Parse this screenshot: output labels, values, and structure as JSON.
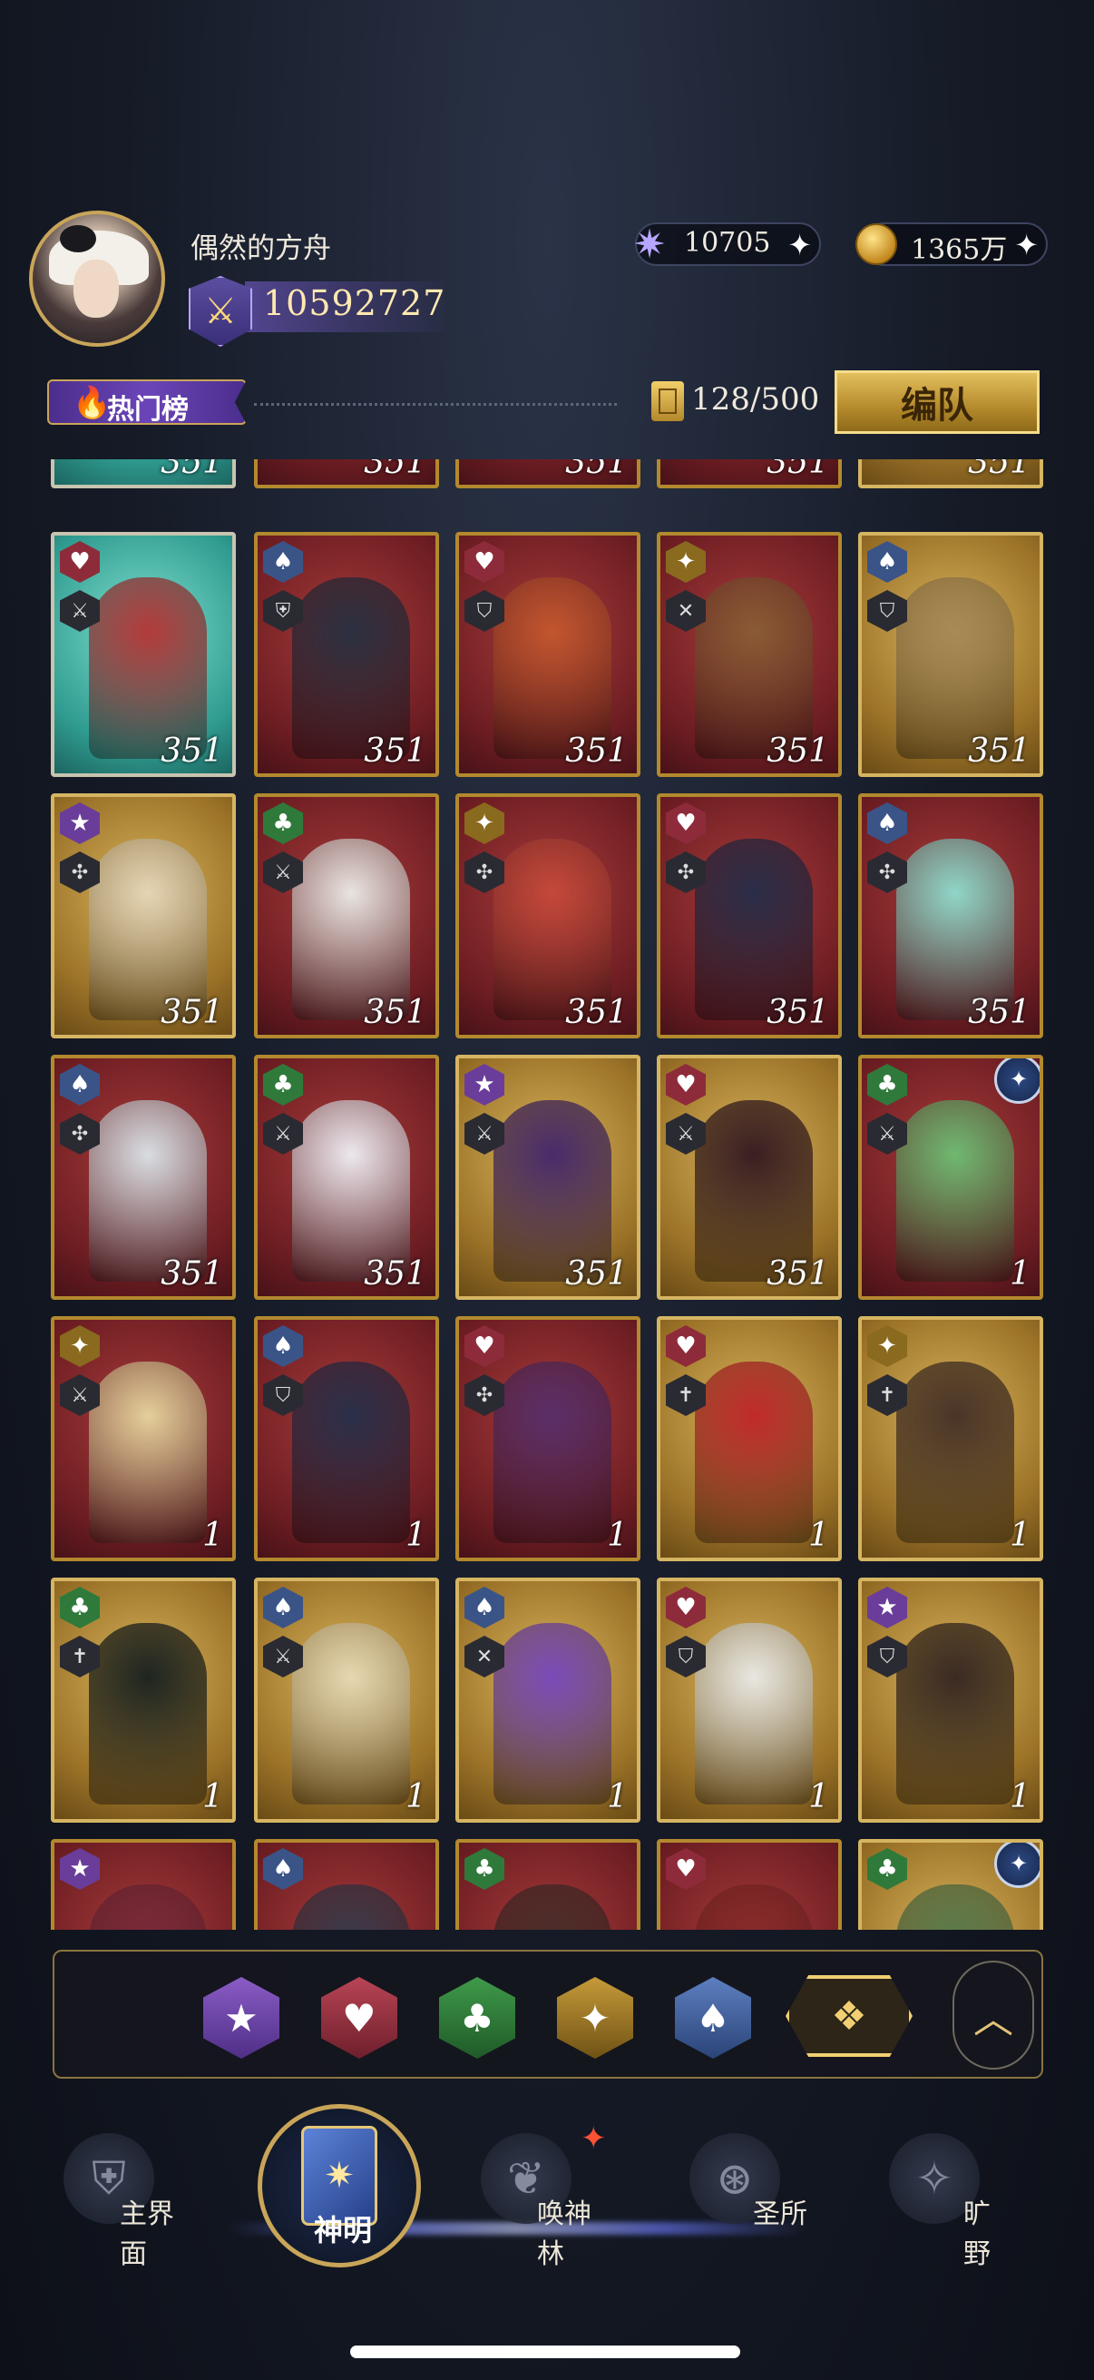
{
  "player": {
    "name": "偶然的方舟",
    "power": "10592727",
    "power_icon": "crossed-swords-icon"
  },
  "currencies": [
    {
      "icon": "crystal-icon",
      "value": "10705",
      "plus": "✦"
    },
    {
      "icon": "gold-coin-icon",
      "value": "1365万",
      "plus": "✦"
    }
  ],
  "toolbar": {
    "hot_tab": "热门榜",
    "hot_icon": "flame-icon",
    "card_count": "128/500",
    "formation_button": "编队"
  },
  "colors": {
    "accent_gold": "#c9a559",
    "card_red": "#6c1d22",
    "card_gold": "#9c7328",
    "bg_dark": "#151a26"
  },
  "cards_top_partial": [
    {
      "suit": "",
      "level": "351",
      "frame": "teal"
    },
    {
      "suit": "",
      "level": "351",
      "frame": "red"
    },
    {
      "suit": "",
      "level": "351",
      "frame": "red"
    },
    {
      "suit": "",
      "level": "351",
      "frame": "red"
    },
    {
      "suit": "",
      "level": "351",
      "frame": "gold"
    }
  ],
  "cards": [
    {
      "suit": "heart",
      "role": "⚔",
      "level": "351",
      "frame": "teal",
      "portrait": "#b23a3a"
    },
    {
      "suit": "spade",
      "role": "⛨",
      "level": "351",
      "frame": "red",
      "portrait": "#2b3040"
    },
    {
      "suit": "heart",
      "role": "⛉",
      "level": "351",
      "frame": "red",
      "portrait": "#c2552e"
    },
    {
      "suit": "diamond",
      "role": "✕",
      "level": "351",
      "frame": "red",
      "portrait": "#8a5a34"
    },
    {
      "suit": "spade",
      "role": "⛉",
      "level": "351",
      "frame": "gold",
      "portrait": "#a98a55"
    },
    {
      "suit": "star",
      "role": "✣",
      "level": "351",
      "frame": "gold",
      "portrait": "#e5d4b4"
    },
    {
      "suit": "club",
      "role": "⚔",
      "level": "351",
      "frame": "red",
      "portrait": "#e8e4e0"
    },
    {
      "suit": "diamond",
      "role": "✣",
      "level": "351",
      "frame": "red",
      "portrait": "#c4483a"
    },
    {
      "suit": "heart",
      "role": "✣",
      "level": "351",
      "frame": "red",
      "portrait": "#2a2d48"
    },
    {
      "suit": "spade",
      "role": "✣",
      "level": "351",
      "frame": "red",
      "portrait": "#8fd6c8"
    },
    {
      "suit": "spade",
      "role": "✣",
      "level": "351",
      "frame": "red",
      "portrait": "#d8dde2"
    },
    {
      "suit": "club",
      "role": "⚔",
      "level": "351",
      "frame": "red",
      "portrait": "#ece8ee"
    },
    {
      "suit": "star",
      "role": "⚔",
      "level": "351",
      "frame": "gold",
      "portrait": "#4a2a6a"
    },
    {
      "suit": "heart",
      "role": "⚔",
      "level": "351",
      "frame": "gold",
      "portrait": "#3a1e22"
    },
    {
      "suit": "club",
      "role": "⚔",
      "level": "1",
      "frame": "red",
      "portrait": "#6fb870",
      "emblem": "✦"
    },
    {
      "suit": "diamond",
      "role": "⚔",
      "level": "1",
      "frame": "red",
      "portrait": "#e4cf9a"
    },
    {
      "suit": "spade",
      "role": "⛉",
      "level": "1",
      "frame": "red",
      "portrait": "#2a2f4a"
    },
    {
      "suit": "heart",
      "role": "✣",
      "level": "1",
      "frame": "red",
      "portrait": "#5a2e68"
    },
    {
      "suit": "heart",
      "role": "✝",
      "level": "1",
      "frame": "gold",
      "portrait": "#c02a2a"
    },
    {
      "suit": "diamond",
      "role": "✝",
      "level": "1",
      "frame": "gold",
      "portrait": "#4a3428"
    },
    {
      "suit": "club",
      "role": "✝",
      "level": "1",
      "frame": "gold",
      "portrait": "#1e2420"
    },
    {
      "suit": "spade",
      "role": "⚔",
      "level": "1",
      "frame": "gold",
      "portrait": "#e6d7b0"
    },
    {
      "suit": "spade",
      "role": "✕",
      "level": "1",
      "frame": "gold",
      "portrait": "#7a4ab8"
    },
    {
      "suit": "heart",
      "role": "⛉",
      "level": "1",
      "frame": "gold",
      "portrait": "#e8e6e0"
    },
    {
      "suit": "star",
      "role": "⛉",
      "level": "1",
      "frame": "gold",
      "portrait": "#3a2a22"
    },
    {
      "suit": "star",
      "role": "",
      "level": "",
      "frame": "red",
      "portrait": "#7a2a3a"
    },
    {
      "suit": "spade",
      "role": "",
      "level": "",
      "frame": "red",
      "portrait": "#3a3a4a"
    },
    {
      "suit": "club",
      "role": "",
      "level": "",
      "frame": "red",
      "portrait": "#4a2e2a"
    },
    {
      "suit": "heart",
      "role": "",
      "level": "",
      "frame": "red",
      "portrait": "#8a2a2a"
    },
    {
      "suit": "club",
      "role": "",
      "level": "",
      "frame": "gold",
      "portrait": "#5a7a4a",
      "emblem": "✦"
    }
  ],
  "suit_glyphs": {
    "heart": "♥",
    "spade": "♠",
    "club": "♣",
    "diamond": "✦",
    "star": "★"
  },
  "filters": [
    {
      "key": "star",
      "glyph": "★",
      "icon": "star-suit-icon"
    },
    {
      "key": "heart",
      "glyph": "♥",
      "icon": "heart-suit-icon"
    },
    {
      "key": "club",
      "glyph": "♣",
      "icon": "club-suit-icon"
    },
    {
      "key": "diamond",
      "glyph": "✦",
      "icon": "diamond-suit-icon"
    },
    {
      "key": "spade",
      "glyph": "♠",
      "icon": "spade-suit-icon"
    }
  ],
  "filter_all_glyph": "❖",
  "filter_collapse_glyph": "︿",
  "nav": {
    "home": "主界面",
    "gods": "神明",
    "summon": "唤神林",
    "sanctuary": "圣所",
    "wilds": "旷野",
    "gods_glyph": "✷",
    "home_glyph": "⛨",
    "summon_glyph": "❦",
    "sanctuary_glyph": "⊛",
    "wilds_glyph": "✧",
    "notify_glyph": "✦"
  }
}
